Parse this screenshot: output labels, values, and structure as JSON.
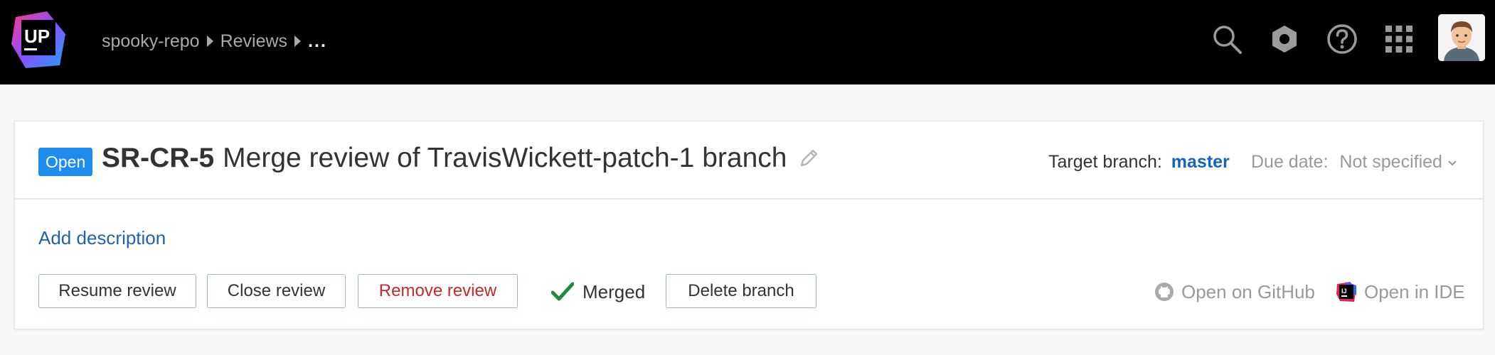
{
  "header": {
    "logo_text": "UP",
    "breadcrumb": [
      "spooky-repo",
      "Reviews",
      "..."
    ],
    "icons": [
      "search-icon",
      "settings-hex-icon",
      "help-icon",
      "apps-grid-icon"
    ],
    "avatar": "user-avatar"
  },
  "review": {
    "status": "Open",
    "key": "SR-CR-5",
    "title": "Merge review of TravisWickett-patch-1 branch",
    "target_label": "Target branch:",
    "target_branch": "master",
    "due_label": "Due date:",
    "due_value": "Not specified",
    "add_description": "Add description"
  },
  "actions": {
    "resume": "Resume review",
    "close": "Close review",
    "remove": "Remove review",
    "merged": "Merged",
    "delete_branch": "Delete branch",
    "open_github": "Open on GitHub",
    "open_ide": "Open in IDE"
  },
  "colors": {
    "topbar": "#000000",
    "accent": "#1f8ded",
    "link": "#1f63b0",
    "danger": "#c62828",
    "success": "#1e8a3c"
  }
}
